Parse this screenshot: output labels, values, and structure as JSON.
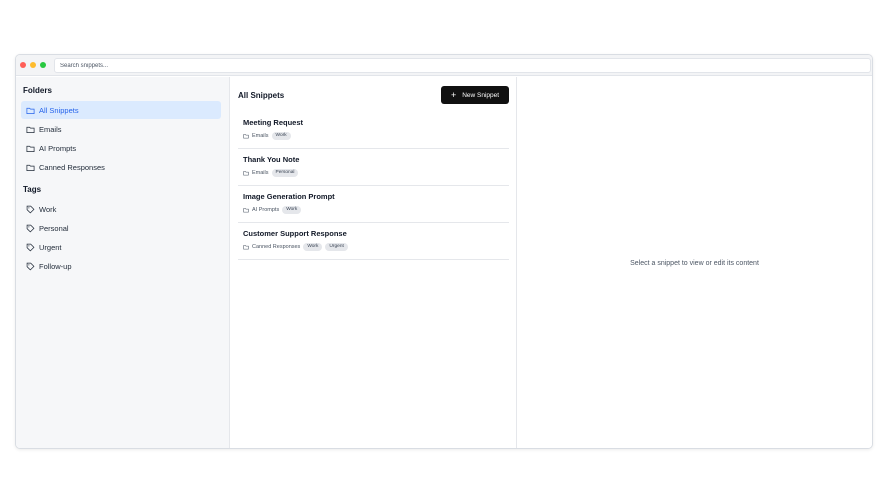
{
  "search": {
    "placeholder": "Search snippets..."
  },
  "sidebar": {
    "folders_title": "Folders",
    "folders": [
      {
        "label": "All Snippets",
        "icon": "folder-icon",
        "active": true
      },
      {
        "label": "Emails",
        "icon": "folder-icon"
      },
      {
        "label": "AI Prompts",
        "icon": "folder-icon"
      },
      {
        "label": "Canned Responses",
        "icon": "folder-icon"
      }
    ],
    "tags_title": "Tags",
    "tags": [
      {
        "label": "Work",
        "icon": "tag-icon"
      },
      {
        "label": "Personal",
        "icon": "tag-icon"
      },
      {
        "label": "Urgent",
        "icon": "tag-icon"
      },
      {
        "label": "Follow-up",
        "icon": "tag-icon"
      }
    ]
  },
  "list": {
    "title": "All Snippets",
    "new_button_icon": "+",
    "new_button_label": "New Snippet",
    "snippets": [
      {
        "title": "Meeting Request",
        "folder": "Emails",
        "tags": [
          "Work"
        ]
      },
      {
        "title": "Thank You Note",
        "folder": "Emails",
        "tags": [
          "Personal"
        ]
      },
      {
        "title": "Image Generation Prompt",
        "folder": "AI Prompts",
        "tags": [
          "Work"
        ]
      },
      {
        "title": "Customer Support Response",
        "folder": "Canned Responses",
        "tags": [
          "Work",
          "Urgent"
        ]
      }
    ]
  },
  "detail": {
    "empty_message": "Select a snippet to view or edit its content"
  },
  "colors": {
    "accent": "#2563eb",
    "active_bg": "#dbeafe",
    "button_bg": "#111111",
    "traffic_red": "#ff5f57",
    "traffic_yellow": "#febc2e",
    "traffic_green": "#28c840"
  }
}
